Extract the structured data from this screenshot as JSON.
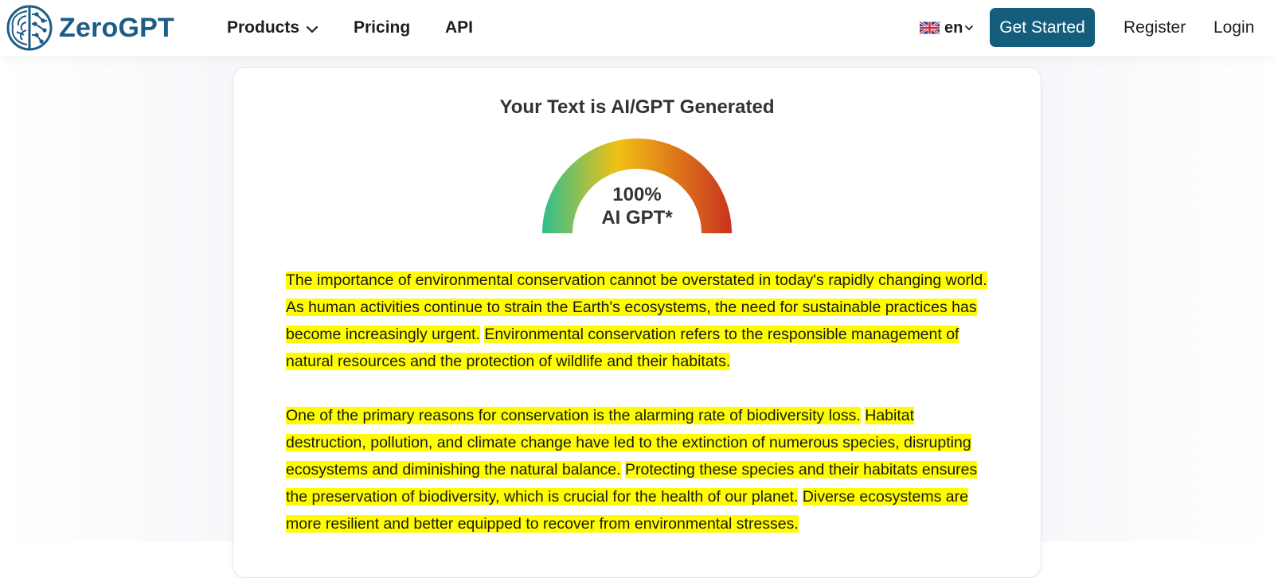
{
  "header": {
    "brand": "ZeroGPT",
    "nav": {
      "products": "Products",
      "pricing": "Pricing",
      "api": "API"
    },
    "language": "en",
    "get_started": "Get Started",
    "register": "Register",
    "login": "Login"
  },
  "result": {
    "title": "Your Text is AI/GPT Generated",
    "gauge_percent": "100%",
    "gauge_label": "AI GPT*",
    "gauge_value": 1.0
  },
  "content": {
    "paragraphs": [
      [
        "The importance of environmental conservation cannot be overstated in today's rapidly changing world. As human activities continue to strain the Earth's ecosystems, the need for sustainable practices has become increasingly urgent.",
        "Environmental conservation refers to the responsible management of natural resources and the protection of wildlife and their habitats."
      ],
      [
        "One of the primary reasons for conservation is the alarming rate of biodiversity loss.",
        "Habitat destruction, pollution, and climate change have led to the extinction of numerous species, disrupting ecosystems and diminishing the natural balance.",
        "Protecting these species and their habitats ensures the preservation of biodiversity, which is crucial for the health of our planet.",
        "Diverse ecosystems are more resilient and better equipped to recover from environmental stresses."
      ]
    ]
  },
  "colors": {
    "brand": "#1d5c85",
    "button": "#155d7c",
    "highlight": "#fffb00",
    "gauge_start": "#2fbf8f",
    "gauge_mid": "#f2c014",
    "gauge_end": "#c9321f"
  },
  "icons": {
    "logo": "brain-logo-icon",
    "products_dropdown": "chevron-down-icon",
    "language_flag": "uk-flag-icon",
    "language_dropdown": "chevron-down-icon"
  }
}
